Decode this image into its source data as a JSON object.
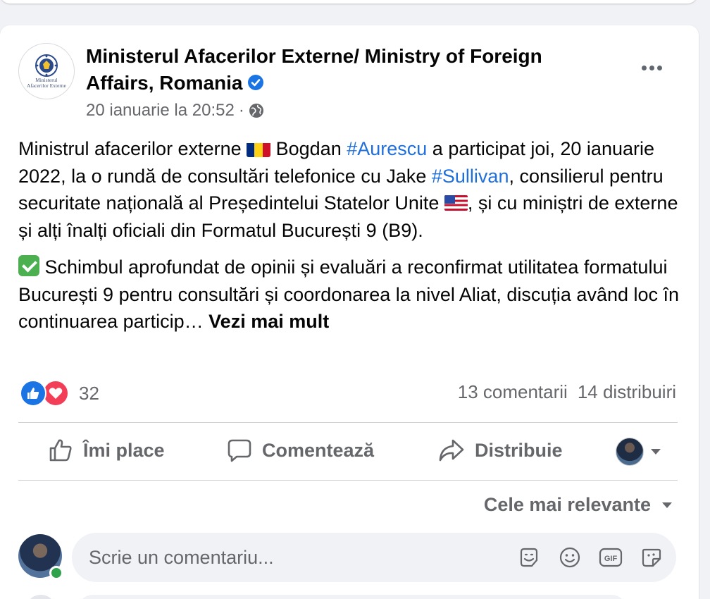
{
  "post": {
    "author": "Ministerul Afacerilor Externe/ Ministry of Foreign Affairs, Romania",
    "avatar_text_1": "Ministerul",
    "avatar_text_2": "Afacerilor Externe",
    "timestamp": "20 ianuarie la 20:52",
    "meta_separator": "·",
    "p1": {
      "a": "Ministrul afacerilor externe ",
      "b": " Bogdan ",
      "tag1": "#Aurescu",
      "c": " a participat joi, 20 ianuarie 2022, la o rundă de consultări telefonice cu Jake ",
      "tag2": "#Sullivan",
      "d": ", consilierul pentru securitate națională al Președintelui Statelor Unite ",
      "e": ", și cu miniștri de externe și alți înalți oficiali din Formatul București 9 (B9)."
    },
    "p2": {
      "a": " Schimbul aprofundat de opinii și evaluări a reconfirmat utilitatea formatului București 9 pentru consultări și coordonarea la nivel Aliat, discuția având loc în continuarea particip… ",
      "see_more": "Vezi mai mult"
    },
    "reactions_count": "32",
    "comments_count": "13 comentarii",
    "shares_count": "14 distribuiri"
  },
  "actions": {
    "like": "Îmi place",
    "comment": "Comentează",
    "share": "Distribuie"
  },
  "sort_label": "Cele mai relevante",
  "comment_input": {
    "placeholder": "Scrie un comentariu..."
  },
  "icons": [
    "verified-icon",
    "globe-icon",
    "more-icon",
    "like-reaction-icon",
    "love-reaction-icon",
    "like-icon",
    "comment-icon",
    "share-icon",
    "sticker-icon",
    "emoji-icon",
    "gif-icon",
    "avatar-sticker-icon"
  ],
  "colors": {
    "link": "#216fdb",
    "verified": "#1b74e4",
    "muted": "#65676b",
    "love": "#f33e58",
    "online": "#31a24c"
  }
}
